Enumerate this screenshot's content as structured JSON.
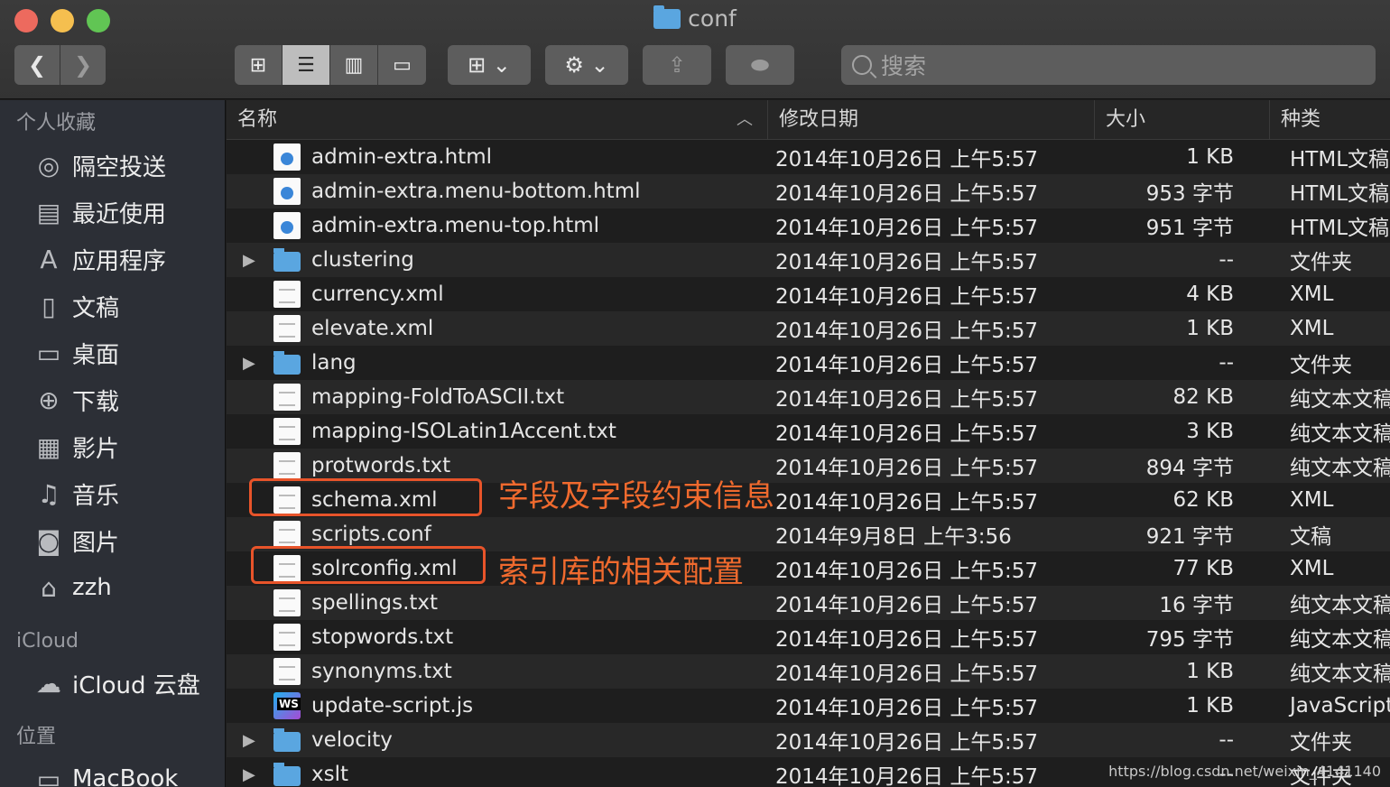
{
  "window": {
    "title": "conf"
  },
  "toolbar": {
    "back": "‹",
    "forward": "›",
    "views": [
      "icon-view",
      "list-view",
      "column-view",
      "gallery-view"
    ],
    "search_placeholder": "搜索"
  },
  "sidebar": {
    "favorites_label": "个人收藏",
    "favorites": [
      {
        "label": "隔空投送",
        "icon": "airdrop-icon"
      },
      {
        "label": "最近使用",
        "icon": "recents-icon"
      },
      {
        "label": "应用程序",
        "icon": "applications-icon"
      },
      {
        "label": "文稿",
        "icon": "documents-icon"
      },
      {
        "label": "桌面",
        "icon": "desktop-icon"
      },
      {
        "label": "下载",
        "icon": "downloads-icon"
      },
      {
        "label": "影片",
        "icon": "movies-icon"
      },
      {
        "label": "音乐",
        "icon": "music-icon"
      },
      {
        "label": "图片",
        "icon": "pictures-icon"
      },
      {
        "label": "zzh",
        "icon": "home-icon"
      }
    ],
    "icloud_label": "iCloud",
    "icloud_items": [
      {
        "label": "iCloud 云盘",
        "icon": "cloud-icon"
      }
    ],
    "locations_label": "位置",
    "locations": [
      {
        "label": "MacBook",
        "icon": "laptop-icon"
      }
    ]
  },
  "columns": {
    "name": "名称",
    "date": "修改日期",
    "size": "大小",
    "kind": "种类"
  },
  "files": [
    {
      "name": "admin-extra.html",
      "type": "html",
      "date": "2014年10月26日 上午5:57",
      "size": "1 KB",
      "kind": "HTML文稿"
    },
    {
      "name": "admin-extra.menu-bottom.html",
      "type": "html",
      "date": "2014年10月26日 上午5:57",
      "size": "953 字节",
      "kind": "HTML文稿"
    },
    {
      "name": "admin-extra.menu-top.html",
      "type": "html",
      "date": "2014年10月26日 上午5:57",
      "size": "951 字节",
      "kind": "HTML文稿"
    },
    {
      "name": "clustering",
      "type": "folder",
      "date": "2014年10月26日 上午5:57",
      "size": "--",
      "kind": "文件夹"
    },
    {
      "name": "currency.xml",
      "type": "doc",
      "date": "2014年10月26日 上午5:57",
      "size": "4 KB",
      "kind": "XML"
    },
    {
      "name": "elevate.xml",
      "type": "doc",
      "date": "2014年10月26日 上午5:57",
      "size": "1 KB",
      "kind": "XML"
    },
    {
      "name": "lang",
      "type": "folder",
      "date": "2014年10月26日 上午5:57",
      "size": "--",
      "kind": "文件夹"
    },
    {
      "name": "mapping-FoldToASCII.txt",
      "type": "doc",
      "date": "2014年10月26日 上午5:57",
      "size": "82 KB",
      "kind": "纯文本文稿"
    },
    {
      "name": "mapping-ISOLatin1Accent.txt",
      "type": "doc",
      "date": "2014年10月26日 上午5:57",
      "size": "3 KB",
      "kind": "纯文本文稿"
    },
    {
      "name": "protwords.txt",
      "type": "doc",
      "date": "2014年10月26日 上午5:57",
      "size": "894 字节",
      "kind": "纯文本文稿"
    },
    {
      "name": "schema.xml",
      "type": "doc",
      "date": "2014年10月26日 上午5:57",
      "size": "62 KB",
      "kind": "XML"
    },
    {
      "name": "scripts.conf",
      "type": "doc",
      "date": "2014年9月8日 上午3:56",
      "size": "921 字节",
      "kind": "文稿"
    },
    {
      "name": "solrconfig.xml",
      "type": "doc",
      "date": "2014年10月26日 上午5:57",
      "size": "77 KB",
      "kind": "XML"
    },
    {
      "name": "spellings.txt",
      "type": "doc",
      "date": "2014年10月26日 上午5:57",
      "size": "16 字节",
      "kind": "纯文本文稿"
    },
    {
      "name": "stopwords.txt",
      "type": "doc",
      "date": "2014年10月26日 上午5:57",
      "size": "795 字节",
      "kind": "纯文本文稿"
    },
    {
      "name": "synonyms.txt",
      "type": "doc",
      "date": "2014年10月26日 上午5:57",
      "size": "1 KB",
      "kind": "纯文本文稿"
    },
    {
      "name": "update-script.js",
      "type": "ws",
      "date": "2014年10月26日 上午5:57",
      "size": "1 KB",
      "kind": "JavaScript"
    },
    {
      "name": "velocity",
      "type": "folder",
      "date": "2014年10月26日 上午5:57",
      "size": "--",
      "kind": "文件夹"
    },
    {
      "name": "xslt",
      "type": "folder",
      "date": "2014年10月26日 上午5:57",
      "size": "--",
      "kind": "文件夹"
    }
  ],
  "annotations": {
    "schema": "字段及字段约束信息",
    "solrconfig": "索引库的相关配置",
    "color": "#f06a2e"
  },
  "watermark": "https://blog.csdn.net/weixin_4141140"
}
